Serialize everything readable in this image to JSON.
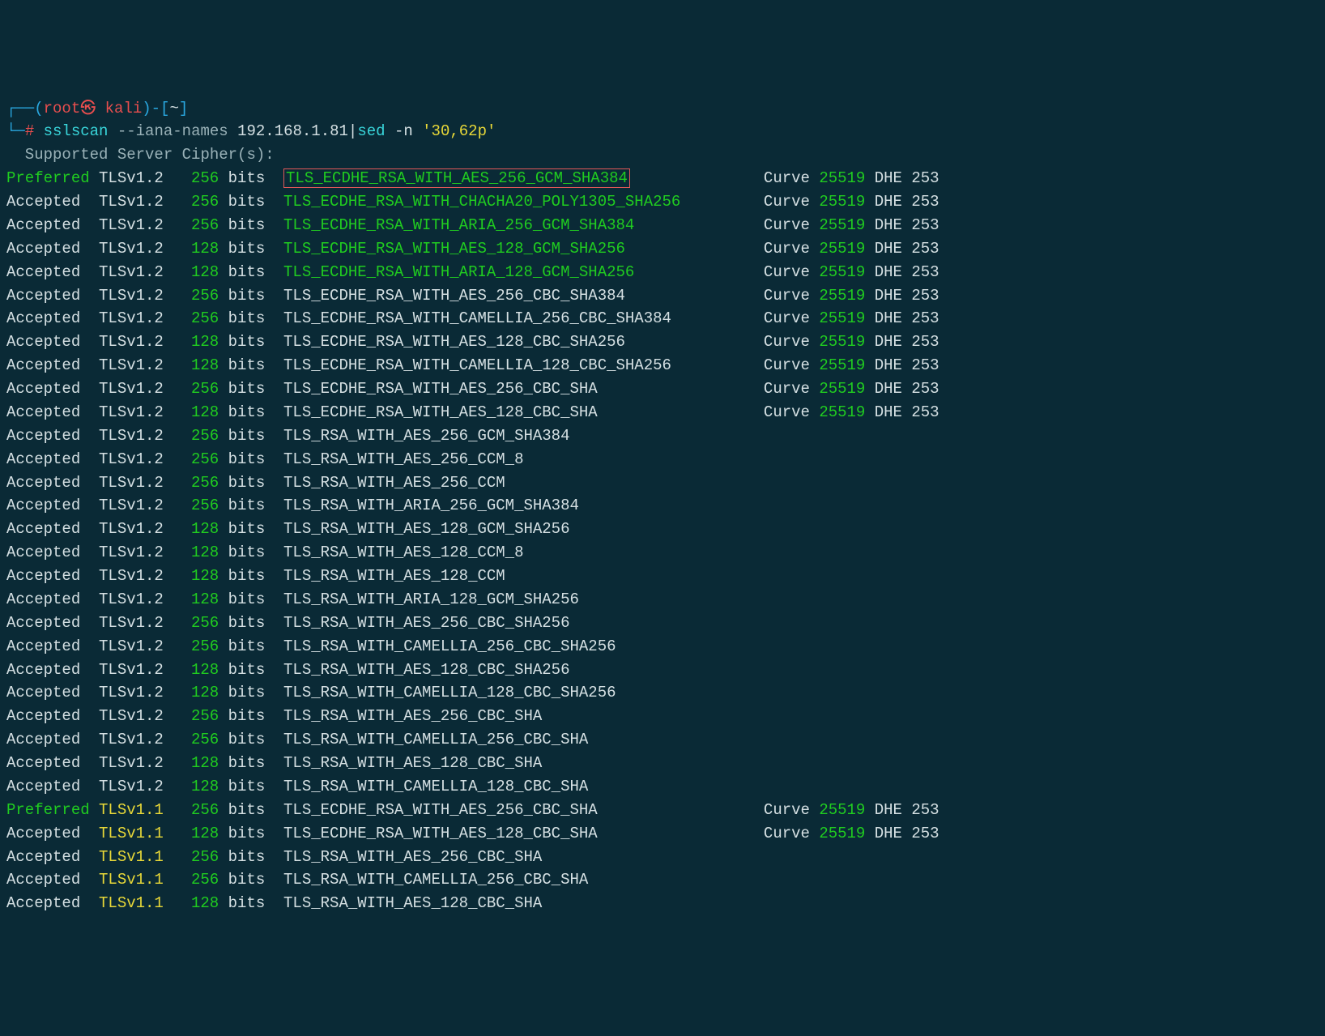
{
  "prompt": {
    "l_bracket": "┌──(",
    "user": "root",
    "sep_glyph": "㉿",
    "host": "kali",
    "close": ")-[",
    "path": "~",
    "r_bracket": "]",
    "line2_prefix": "└─",
    "hash": "#",
    "cmd_bin": "sslscan",
    "cmd_args_grey": " --iana-names ",
    "cmd_args_ip": "192.168.1.81",
    "pipe": "|",
    "sed_bin": "sed",
    "sed_flag": " -n ",
    "sed_arg": "'30,62p'"
  },
  "header": "  Supported Server Cipher(s):",
  "rows": [
    {
      "status": "Preferred",
      "status_color": "green",
      "proto": "TLSv1.2",
      "proto_color": "white",
      "bits": "256",
      "unit": "bits",
      "cipher": "TLS_ECDHE_RSA_WITH_AES_256_GCM_SHA384",
      "cipher_color": "green",
      "boxed": true,
      "curve": "25519",
      "dhe": "253"
    },
    {
      "status": "Accepted",
      "status_color": "white",
      "proto": "TLSv1.2",
      "proto_color": "white",
      "bits": "256",
      "unit": "bits",
      "cipher": "TLS_ECDHE_RSA_WITH_CHACHA20_POLY1305_SHA256",
      "cipher_color": "green",
      "curve": "25519",
      "dhe": "253"
    },
    {
      "status": "Accepted",
      "status_color": "white",
      "proto": "TLSv1.2",
      "proto_color": "white",
      "bits": "256",
      "unit": "bits",
      "cipher": "TLS_ECDHE_RSA_WITH_ARIA_256_GCM_SHA384",
      "cipher_color": "green",
      "curve": "25519",
      "dhe": "253"
    },
    {
      "status": "Accepted",
      "status_color": "white",
      "proto": "TLSv1.2",
      "proto_color": "white",
      "bits": "128",
      "unit": "bits",
      "cipher": "TLS_ECDHE_RSA_WITH_AES_128_GCM_SHA256",
      "cipher_color": "green",
      "curve": "25519",
      "dhe": "253"
    },
    {
      "status": "Accepted",
      "status_color": "white",
      "proto": "TLSv1.2",
      "proto_color": "white",
      "bits": "128",
      "unit": "bits",
      "cipher": "TLS_ECDHE_RSA_WITH_ARIA_128_GCM_SHA256",
      "cipher_color": "green",
      "curve": "25519",
      "dhe": "253"
    },
    {
      "status": "Accepted",
      "status_color": "white",
      "proto": "TLSv1.2",
      "proto_color": "white",
      "bits": "256",
      "unit": "bits",
      "cipher": "TLS_ECDHE_RSA_WITH_AES_256_CBC_SHA384",
      "cipher_color": "white",
      "curve": "25519",
      "dhe": "253"
    },
    {
      "status": "Accepted",
      "status_color": "white",
      "proto": "TLSv1.2",
      "proto_color": "white",
      "bits": "256",
      "unit": "bits",
      "cipher": "TLS_ECDHE_RSA_WITH_CAMELLIA_256_CBC_SHA384",
      "cipher_color": "white",
      "curve": "25519",
      "dhe": "253"
    },
    {
      "status": "Accepted",
      "status_color": "white",
      "proto": "TLSv1.2",
      "proto_color": "white",
      "bits": "128",
      "unit": "bits",
      "cipher": "TLS_ECDHE_RSA_WITH_AES_128_CBC_SHA256",
      "cipher_color": "white",
      "curve": "25519",
      "dhe": "253"
    },
    {
      "status": "Accepted",
      "status_color": "white",
      "proto": "TLSv1.2",
      "proto_color": "white",
      "bits": "128",
      "unit": "bits",
      "cipher": "TLS_ECDHE_RSA_WITH_CAMELLIA_128_CBC_SHA256",
      "cipher_color": "white",
      "curve": "25519",
      "dhe": "253"
    },
    {
      "status": "Accepted",
      "status_color": "white",
      "proto": "TLSv1.2",
      "proto_color": "white",
      "bits": "256",
      "unit": "bits",
      "cipher": "TLS_ECDHE_RSA_WITH_AES_256_CBC_SHA",
      "cipher_color": "white",
      "curve": "25519",
      "dhe": "253"
    },
    {
      "status": "Accepted",
      "status_color": "white",
      "proto": "TLSv1.2",
      "proto_color": "white",
      "bits": "128",
      "unit": "bits",
      "cipher": "TLS_ECDHE_RSA_WITH_AES_128_CBC_SHA",
      "cipher_color": "white",
      "curve": "25519",
      "dhe": "253"
    },
    {
      "status": "Accepted",
      "status_color": "white",
      "proto": "TLSv1.2",
      "proto_color": "white",
      "bits": "256",
      "unit": "bits",
      "cipher": "TLS_RSA_WITH_AES_256_GCM_SHA384",
      "cipher_color": "white"
    },
    {
      "status": "Accepted",
      "status_color": "white",
      "proto": "TLSv1.2",
      "proto_color": "white",
      "bits": "256",
      "unit": "bits",
      "cipher": "TLS_RSA_WITH_AES_256_CCM_8",
      "cipher_color": "white"
    },
    {
      "status": "Accepted",
      "status_color": "white",
      "proto": "TLSv1.2",
      "proto_color": "white",
      "bits": "256",
      "unit": "bits",
      "cipher": "TLS_RSA_WITH_AES_256_CCM",
      "cipher_color": "white"
    },
    {
      "status": "Accepted",
      "status_color": "white",
      "proto": "TLSv1.2",
      "proto_color": "white",
      "bits": "256",
      "unit": "bits",
      "cipher": "TLS_RSA_WITH_ARIA_256_GCM_SHA384",
      "cipher_color": "white"
    },
    {
      "status": "Accepted",
      "status_color": "white",
      "proto": "TLSv1.2",
      "proto_color": "white",
      "bits": "128",
      "unit": "bits",
      "cipher": "TLS_RSA_WITH_AES_128_GCM_SHA256",
      "cipher_color": "white"
    },
    {
      "status": "Accepted",
      "status_color": "white",
      "proto": "TLSv1.2",
      "proto_color": "white",
      "bits": "128",
      "unit": "bits",
      "cipher": "TLS_RSA_WITH_AES_128_CCM_8",
      "cipher_color": "white"
    },
    {
      "status": "Accepted",
      "status_color": "white",
      "proto": "TLSv1.2",
      "proto_color": "white",
      "bits": "128",
      "unit": "bits",
      "cipher": "TLS_RSA_WITH_AES_128_CCM",
      "cipher_color": "white"
    },
    {
      "status": "Accepted",
      "status_color": "white",
      "proto": "TLSv1.2",
      "proto_color": "white",
      "bits": "128",
      "unit": "bits",
      "cipher": "TLS_RSA_WITH_ARIA_128_GCM_SHA256",
      "cipher_color": "white"
    },
    {
      "status": "Accepted",
      "status_color": "white",
      "proto": "TLSv1.2",
      "proto_color": "white",
      "bits": "256",
      "unit": "bits",
      "cipher": "TLS_RSA_WITH_AES_256_CBC_SHA256",
      "cipher_color": "white"
    },
    {
      "status": "Accepted",
      "status_color": "white",
      "proto": "TLSv1.2",
      "proto_color": "white",
      "bits": "256",
      "unit": "bits",
      "cipher": "TLS_RSA_WITH_CAMELLIA_256_CBC_SHA256",
      "cipher_color": "white"
    },
    {
      "status": "Accepted",
      "status_color": "white",
      "proto": "TLSv1.2",
      "proto_color": "white",
      "bits": "128",
      "unit": "bits",
      "cipher": "TLS_RSA_WITH_AES_128_CBC_SHA256",
      "cipher_color": "white"
    },
    {
      "status": "Accepted",
      "status_color": "white",
      "proto": "TLSv1.2",
      "proto_color": "white",
      "bits": "128",
      "unit": "bits",
      "cipher": "TLS_RSA_WITH_CAMELLIA_128_CBC_SHA256",
      "cipher_color": "white"
    },
    {
      "status": "Accepted",
      "status_color": "white",
      "proto": "TLSv1.2",
      "proto_color": "white",
      "bits": "256",
      "unit": "bits",
      "cipher": "TLS_RSA_WITH_AES_256_CBC_SHA",
      "cipher_color": "white"
    },
    {
      "status": "Accepted",
      "status_color": "white",
      "proto": "TLSv1.2",
      "proto_color": "white",
      "bits": "256",
      "unit": "bits",
      "cipher": "TLS_RSA_WITH_CAMELLIA_256_CBC_SHA",
      "cipher_color": "white"
    },
    {
      "status": "Accepted",
      "status_color": "white",
      "proto": "TLSv1.2",
      "proto_color": "white",
      "bits": "128",
      "unit": "bits",
      "cipher": "TLS_RSA_WITH_AES_128_CBC_SHA",
      "cipher_color": "white"
    },
    {
      "status": "Accepted",
      "status_color": "white",
      "proto": "TLSv1.2",
      "proto_color": "white",
      "bits": "128",
      "unit": "bits",
      "cipher": "TLS_RSA_WITH_CAMELLIA_128_CBC_SHA",
      "cipher_color": "white"
    },
    {
      "status": "Preferred",
      "status_color": "green",
      "proto": "TLSv1.1",
      "proto_color": "yellow",
      "bits": "256",
      "unit": "bits",
      "cipher": "TLS_ECDHE_RSA_WITH_AES_256_CBC_SHA",
      "cipher_color": "white",
      "curve": "25519",
      "dhe": "253"
    },
    {
      "status": "Accepted",
      "status_color": "white",
      "proto": "TLSv1.1",
      "proto_color": "yellow",
      "bits": "128",
      "unit": "bits",
      "cipher": "TLS_ECDHE_RSA_WITH_AES_128_CBC_SHA",
      "cipher_color": "white",
      "curve": "25519",
      "dhe": "253"
    },
    {
      "status": "Accepted",
      "status_color": "white",
      "proto": "TLSv1.1",
      "proto_color": "yellow",
      "bits": "256",
      "unit": "bits",
      "cipher": "TLS_RSA_WITH_AES_256_CBC_SHA",
      "cipher_color": "white"
    },
    {
      "status": "Accepted",
      "status_color": "white",
      "proto": "TLSv1.1",
      "proto_color": "yellow",
      "bits": "256",
      "unit": "bits",
      "cipher": "TLS_RSA_WITH_CAMELLIA_256_CBC_SHA",
      "cipher_color": "white"
    },
    {
      "status": "Accepted",
      "status_color": "white",
      "proto": "TLSv1.1",
      "proto_color": "yellow",
      "bits": "128",
      "unit": "bits",
      "cipher": "TLS_RSA_WITH_AES_128_CBC_SHA",
      "cipher_color": "white"
    }
  ],
  "labels": {
    "curve": "Curve",
    "dhe": "DHE"
  }
}
